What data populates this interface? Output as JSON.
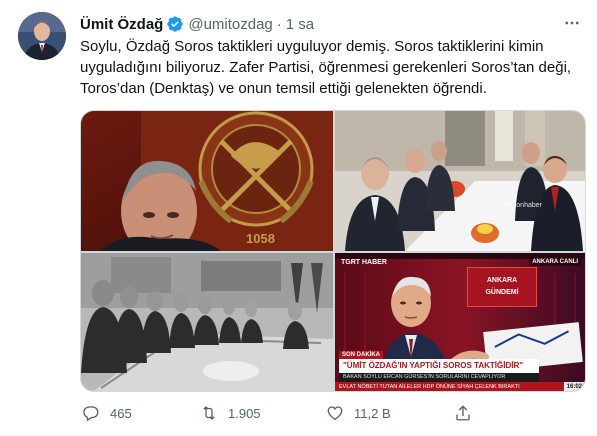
{
  "author": {
    "display_name": "Ümit Özdağ",
    "handle": "@umitozdag",
    "separator": "·",
    "time": "1 sa",
    "verified": true
  },
  "tweet": {
    "lines": [
      "Soylu, Özdağ Soros taktikleri uyguluyor demiş. Soros taktiklerini kimin",
      "uyguladığını biliyoruz. Zafer Partisi, öğrenmesi gerekenleri Soros’tan deği,",
      "Toros’dan (Denktaş) ve onun temsil ettiği gelenekten öğrendi."
    ]
  },
  "media": {
    "photo_1": {
      "emblem_number": "1058"
    },
    "photo_2": {
      "watermark": "ensonhaber"
    },
    "photo_4": {
      "channel": "TGRT HABER",
      "live": "ANKARA CANLI",
      "program_line1": "ANKARA",
      "program_line2": "GÜNDEMİ",
      "kicker": "SON DAKİKA",
      "headline": "\"ÜMİT ÖZDAĞ'IN YAPTIĞI SOROS TAKTİĞİDİR\"",
      "subline": "BAKAN SOYLU ERCAN GÜRSES'İN SORULARINI CEVAPLIYOR",
      "ticker": "EVLAT NÖBETİ TUTAN AİLELER HDP ÖNÜNE SİYAH ÇELENK BIRAKTI",
      "clock": "16:02"
    }
  },
  "actions": {
    "replies": "465",
    "retweets": "1.905",
    "likes": "11,2 B"
  },
  "colors": {
    "text": "#0f1419",
    "secondary": "#536471",
    "verified": "#1d9bf0",
    "border": "#cfd9de"
  },
  "icons": [
    "verified-badge-icon",
    "more-icon",
    "reply-icon",
    "retweet-icon",
    "like-icon",
    "share-icon"
  ]
}
